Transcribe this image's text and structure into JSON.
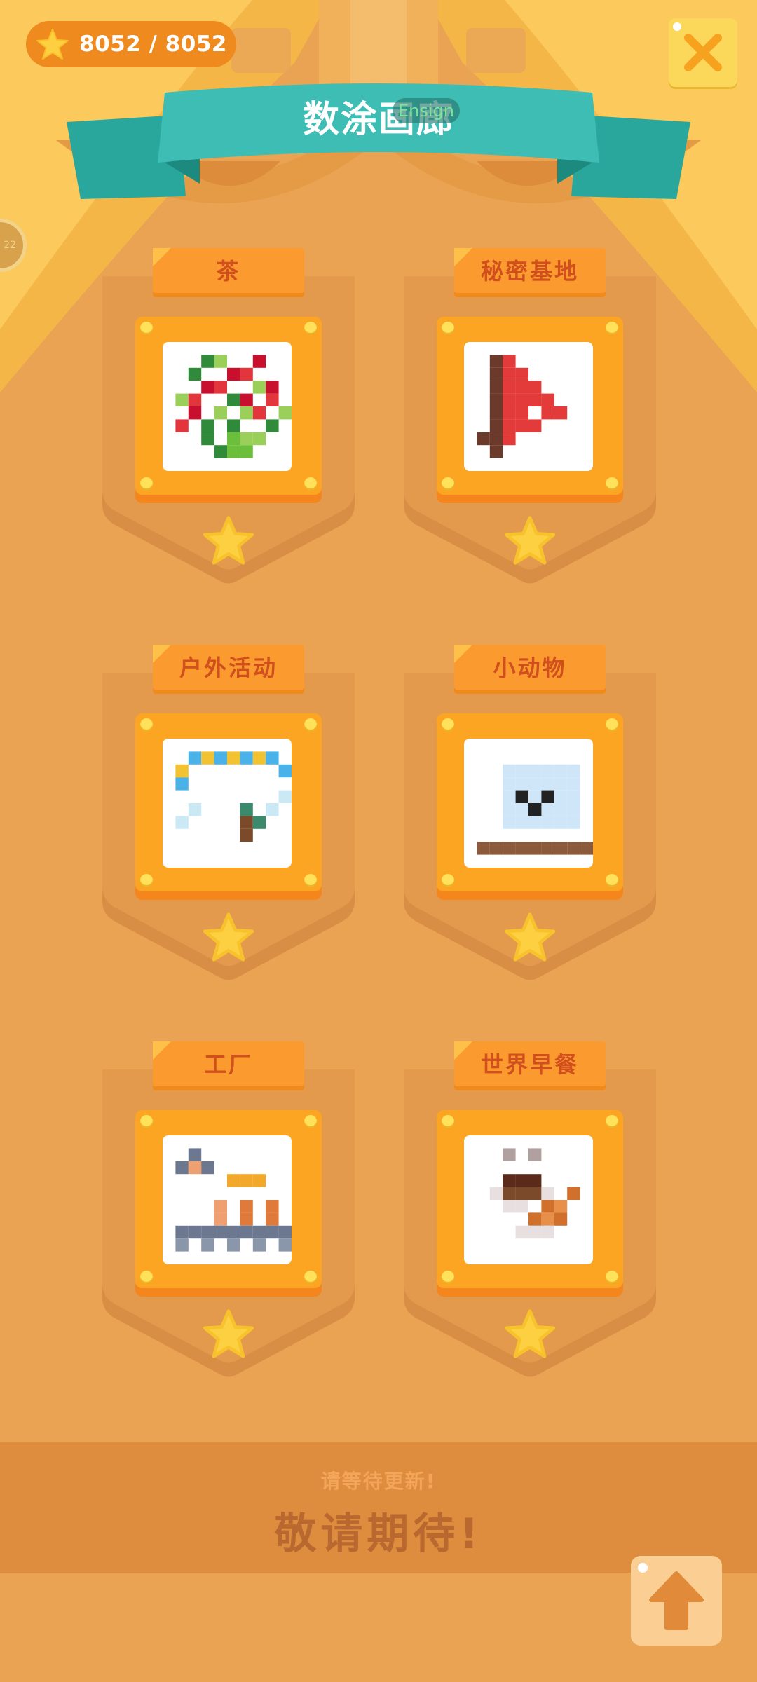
{
  "header": {
    "star_count": "8052 / 8052",
    "banner_title": "数涂画廊",
    "banner_tag": "Ensign",
    "side_badge": "22"
  },
  "albums": [
    {
      "label": "茶",
      "image": "tea-pixel-art"
    },
    {
      "label": "秘密基地",
      "image": "flag-pixel-art"
    },
    {
      "label": "户外活动",
      "image": "hammock-pixel-art"
    },
    {
      "label": "小动物",
      "image": "seal-pixel-art"
    },
    {
      "label": "工厂",
      "image": "factory-pixel-art"
    },
    {
      "label": "世界早餐",
      "image": "breakfast-pixel-art"
    }
  ],
  "footer": {
    "subtitle": "请等待更新!",
    "title": "敬请期待!"
  },
  "colors": {
    "background": "#e9a353",
    "accent_orange": "#fb9a2e",
    "banner_teal": "#3ebdb4",
    "star_yellow": "#fcd040",
    "label_red": "#d04f1c"
  },
  "icons": [
    "star-icon",
    "close-icon",
    "up-arrow-icon"
  ]
}
